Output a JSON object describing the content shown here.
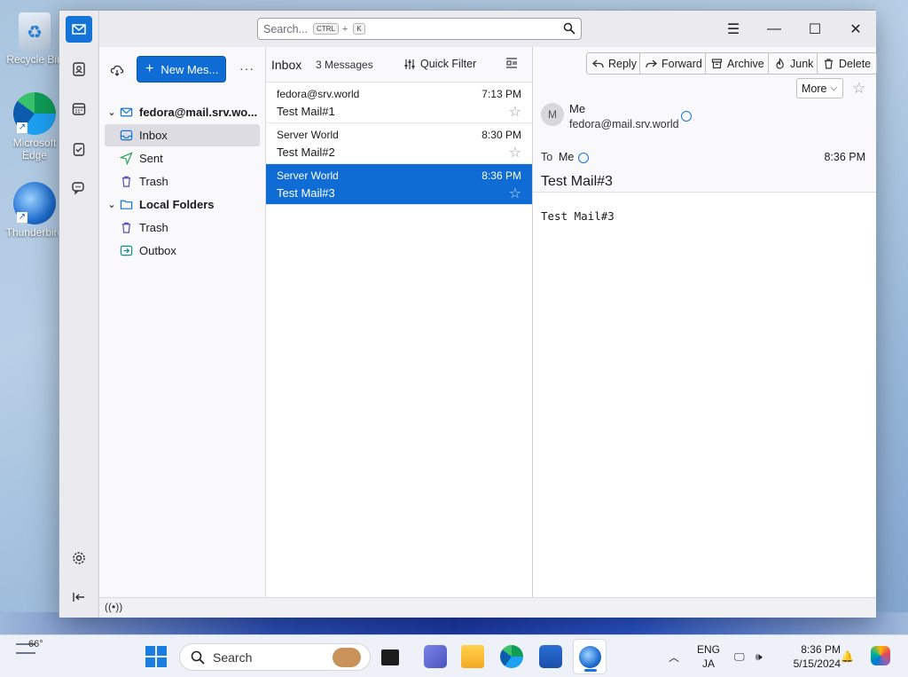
{
  "desktop": {
    "icons": [
      {
        "label": "Recycle Bin"
      },
      {
        "label": "Microsoft Edge"
      },
      {
        "label": "Thunderbird"
      }
    ]
  },
  "window": {
    "search": {
      "placeholder": "Search...",
      "key1": "CTRL",
      "plus": "+",
      "key2": "K"
    },
    "controls": {
      "minimize": "—",
      "maximize": "☐",
      "close": "✕",
      "menu": "☰"
    }
  },
  "folders": {
    "new_message_label": "New Mes...",
    "more_label": "···",
    "items": [
      {
        "label": "fedora@mail.srv.wo...",
        "type": "account"
      },
      {
        "label": "Inbox",
        "type": "inbox",
        "selected": true
      },
      {
        "label": "Sent",
        "type": "sent"
      },
      {
        "label": "Trash",
        "type": "trash"
      },
      {
        "label": "Local Folders",
        "type": "local"
      },
      {
        "label": "Trash",
        "type": "trash"
      },
      {
        "label": "Outbox",
        "type": "outbox"
      }
    ]
  },
  "list": {
    "title": "Inbox",
    "count": "3 Messages",
    "quick_filter": "Quick Filter",
    "messages": [
      {
        "from": "fedora@srv.world",
        "date": "7:13 PM",
        "subject": "Test Mail#1",
        "selected": false
      },
      {
        "from": "Server World",
        "date": "8:30 PM",
        "subject": "Test Mail#2",
        "selected": false
      },
      {
        "from": "Server World",
        "date": "8:36 PM",
        "subject": "Test Mail#3",
        "selected": true
      }
    ]
  },
  "message": {
    "actions": {
      "reply": "Reply",
      "forward": "Forward",
      "archive": "Archive",
      "junk": "Junk",
      "delete": "Delete",
      "more": "More"
    },
    "avatar_letter": "M",
    "sender_name": "Me",
    "sender_address": "fedora@mail.srv.world",
    "to_label": "To",
    "to_value": "Me",
    "date": "8:36 PM",
    "subject": "Test Mail#3",
    "body": "Test Mail#3"
  },
  "taskbar": {
    "weather_temp": "66°",
    "search_label": "Search",
    "lang_top": "ENG",
    "lang_bottom": "JA",
    "time": "8:36 PM",
    "date": "5/15/2024"
  },
  "colors": {
    "accent": "#0f6cd4",
    "selection": "#0f6cd4"
  }
}
